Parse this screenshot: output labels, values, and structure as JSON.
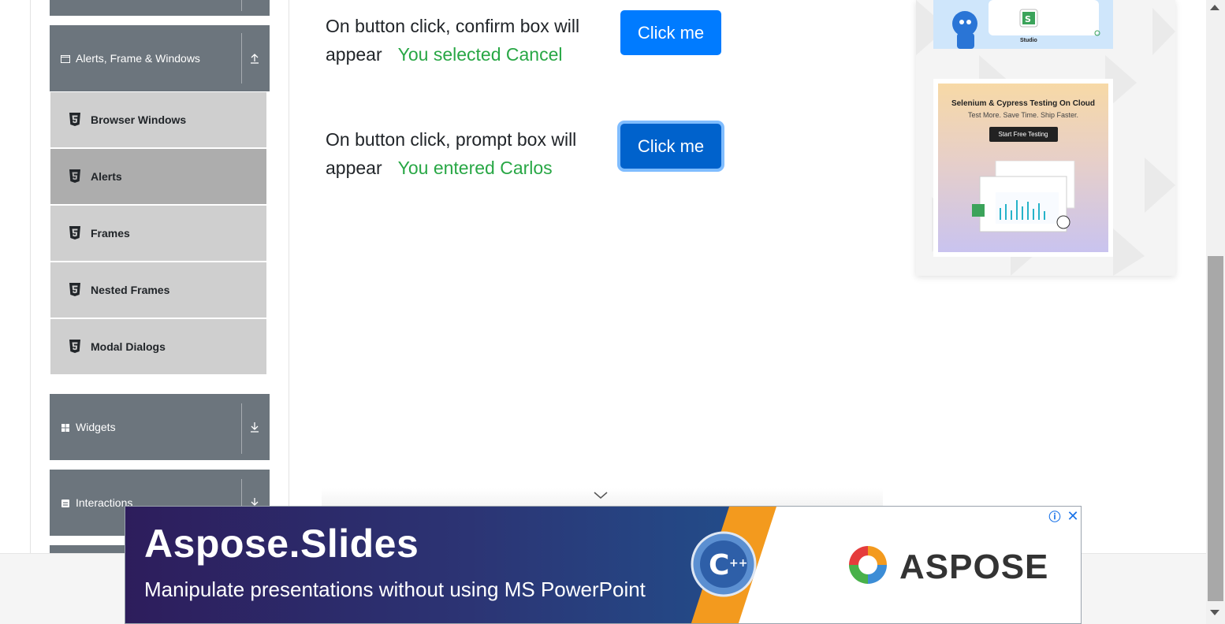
{
  "sidebar": {
    "group_alerts": {
      "label": "Alerts, Frame & Windows",
      "icon": "window-icon",
      "arrow": "arrow-up-icon"
    },
    "items": [
      {
        "label": "Browser Windows",
        "icon": "html5-icon",
        "active": false
      },
      {
        "label": "Alerts",
        "icon": "html5-icon",
        "active": true
      },
      {
        "label": "Frames",
        "icon": "html5-icon",
        "active": false
      },
      {
        "label": "Nested Frames",
        "icon": "html5-icon",
        "active": false
      },
      {
        "label": "Modal Dialogs",
        "icon": "html5-icon",
        "active": false
      }
    ],
    "group_widgets": {
      "label": "Widgets",
      "icon": "grid-icon",
      "arrow": "arrow-down-icon"
    },
    "group_interactions": {
      "label": "Interactions",
      "icon": "form-icon",
      "arrow": "arrow-down-icon"
    }
  },
  "main": {
    "confirm_row": {
      "text": "On button click, confirm box will appear",
      "result": "You selected Cancel",
      "button": "Click me"
    },
    "prompt_row": {
      "text": "On button click, prompt box will appear",
      "result": "You entered Carlos",
      "button": "Click me"
    }
  },
  "right_ads": {
    "top_ad": {
      "label": "Studio"
    },
    "second_ad": {
      "title": "Selenium & Cypress Testing On Cloud",
      "subtitle": "Test More. Save Time. Ship Faster.",
      "cta": "Start Free Testing"
    }
  },
  "banner_ad": {
    "title": "Aspose.Slides",
    "subtitle": "Manipulate presentations without using MS PowerPoint",
    "brand": "ASPOSE",
    "info_icon": "info-icon",
    "close_icon": "close-icon"
  },
  "colors": {
    "sidebar_header": "#6c757d",
    "sub_item": "#cfcfcf",
    "sub_item_active": "#adadad",
    "button": "#007bff",
    "result_text": "#28a745"
  }
}
